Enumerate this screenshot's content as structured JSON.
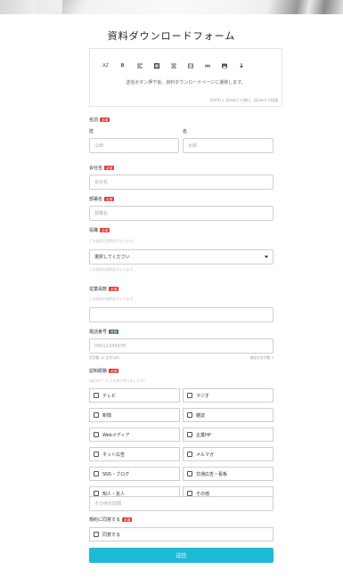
{
  "page": {
    "title": "資料ダウンロードフォーム"
  },
  "editor": {
    "toolbar": [
      {
        "name": "font-size-icon",
        "glyph": "AZ"
      },
      {
        "name": "bold-icon",
        "glyph": "B"
      },
      {
        "name": "align-left-icon",
        "glyph": ""
      },
      {
        "name": "heading-icon",
        "glyph": ""
      },
      {
        "name": "align-center-icon",
        "glyph": ""
      },
      {
        "name": "table-icon",
        "glyph": ""
      },
      {
        "name": "link-icon",
        "glyph": ""
      },
      {
        "name": "image-icon",
        "glyph": ""
      },
      {
        "name": "download-icon",
        "glyph": ""
      }
    ],
    "text": "送信ボタン押下後、資料ダウンロードページに遷移します。",
    "hint": "[Shift] + [Enter] で改行、[Enter] で段落"
  },
  "badges": {
    "required": "必須",
    "optional": "任意"
  },
  "name": {
    "label": "名前",
    "last_label": "姓",
    "last_placeholder": "山田",
    "first_label": "名",
    "first_placeholder": "太郎"
  },
  "company": {
    "label": "会社名",
    "placeholder": "会社名"
  },
  "department": {
    "label": "部署名",
    "placeholder": "部署名"
  },
  "position": {
    "label": "役職",
    "help": "この項目の説明文が入ります。",
    "selected": "選択してください",
    "help2": "この項目の説明文が入ります。"
  },
  "employees": {
    "label": "従業員数",
    "help": "この項目の説明文が入ります。",
    "value": ""
  },
  "phone": {
    "label": "電話番号",
    "placeholder": "09012345678",
    "min_note": "文字数 20 文字以内",
    "count_note": "現在の文字数 0"
  },
  "source": {
    "label": "認知経路",
    "help": "当社のサービスを何で知りましたか？",
    "options": [
      "テレビ",
      "ラジオ",
      "新聞",
      "雑誌",
      "Webメディア",
      "企業HP",
      "ネット広告",
      "メルマガ",
      "SNS・ブログ",
      "交通広告・看板",
      "知人・友人",
      "その他"
    ],
    "other_placeholder": "その他の詳細"
  },
  "agree": {
    "label": "規約に同意する",
    "option": "同意する"
  },
  "submit": {
    "label": "送信"
  },
  "colors": {
    "accent": "#1bbbd8",
    "required": "#e53935",
    "optional": "#546e7a"
  }
}
